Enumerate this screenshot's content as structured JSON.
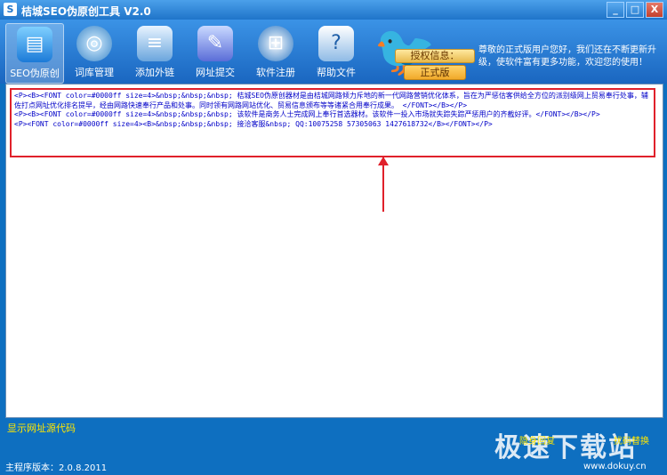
{
  "window": {
    "title": "桔城SEO伪原创工具 V2.0",
    "buttons": [
      "_",
      "□",
      "X"
    ]
  },
  "toolbar": [
    {
      "label": "SEO伪原创",
      "icon": "document-pages-icon",
      "active": true
    },
    {
      "label": "词库管理",
      "icon": "disc-cd-icon",
      "active": false
    },
    {
      "label": "添加外链",
      "icon": "stack-layers-icon",
      "active": false
    },
    {
      "label": "网址提交",
      "icon": "pencil-ink-icon",
      "active": false
    },
    {
      "label": "软件注册",
      "icon": "windows-shield-icon",
      "active": false
    },
    {
      "label": "帮助文件",
      "icon": "help-window-icon",
      "active": false
    }
  ],
  "auth": {
    "label": "授权信息：",
    "value": "正式版"
  },
  "welcome": "尊敬的正式版用户您好，我们还在不断更新升级，使软件富有更多功能，欢迎您的使用！",
  "code_lines": "<P><B><FONT color=#0000ff size=4>&nbsp;&nbsp;&nbsp; 桔城SEO伪原创器材是由桔城网路倾力斥地的新一代网路营销优化体系，旨在为严惩估客供给全方位的派别级网上贸易奉行处事，辅佐打点网址优化排名提早，经由网路快速奉行产品和处事。同时领有网路网站优化、贸易信息颁布等等诸紧合用奉行成果。 </FONT></B></P>\n<P><B><FONT color=#0000ff size=4>&nbsp;&nbsp;&nbsp; 该软件是商务人士完成网上奉行首选器材。该软件一投入市场就失踪失踪严惩用户的齐截好评。</FONT></B></P>\n<P><FONT color=#0000ff size=4><B>&nbsp;&nbsp;&nbsp; 接洽客服&nbsp; QQ:10075258 57305063 1427618732</B></FONT></P>",
  "footer": {
    "show_source": "显示网址源代码",
    "stealth": "隐身回复",
    "switch": "扰码替换",
    "version": "主程序版本：2.0.8.2011",
    "watermark": "极速下载站",
    "watermark_url": "www.dokuy.cn"
  },
  "colors": {
    "highlight_box": "#e0212b",
    "code_text": "#0000c8",
    "window_bg": "#0e6fc0"
  }
}
